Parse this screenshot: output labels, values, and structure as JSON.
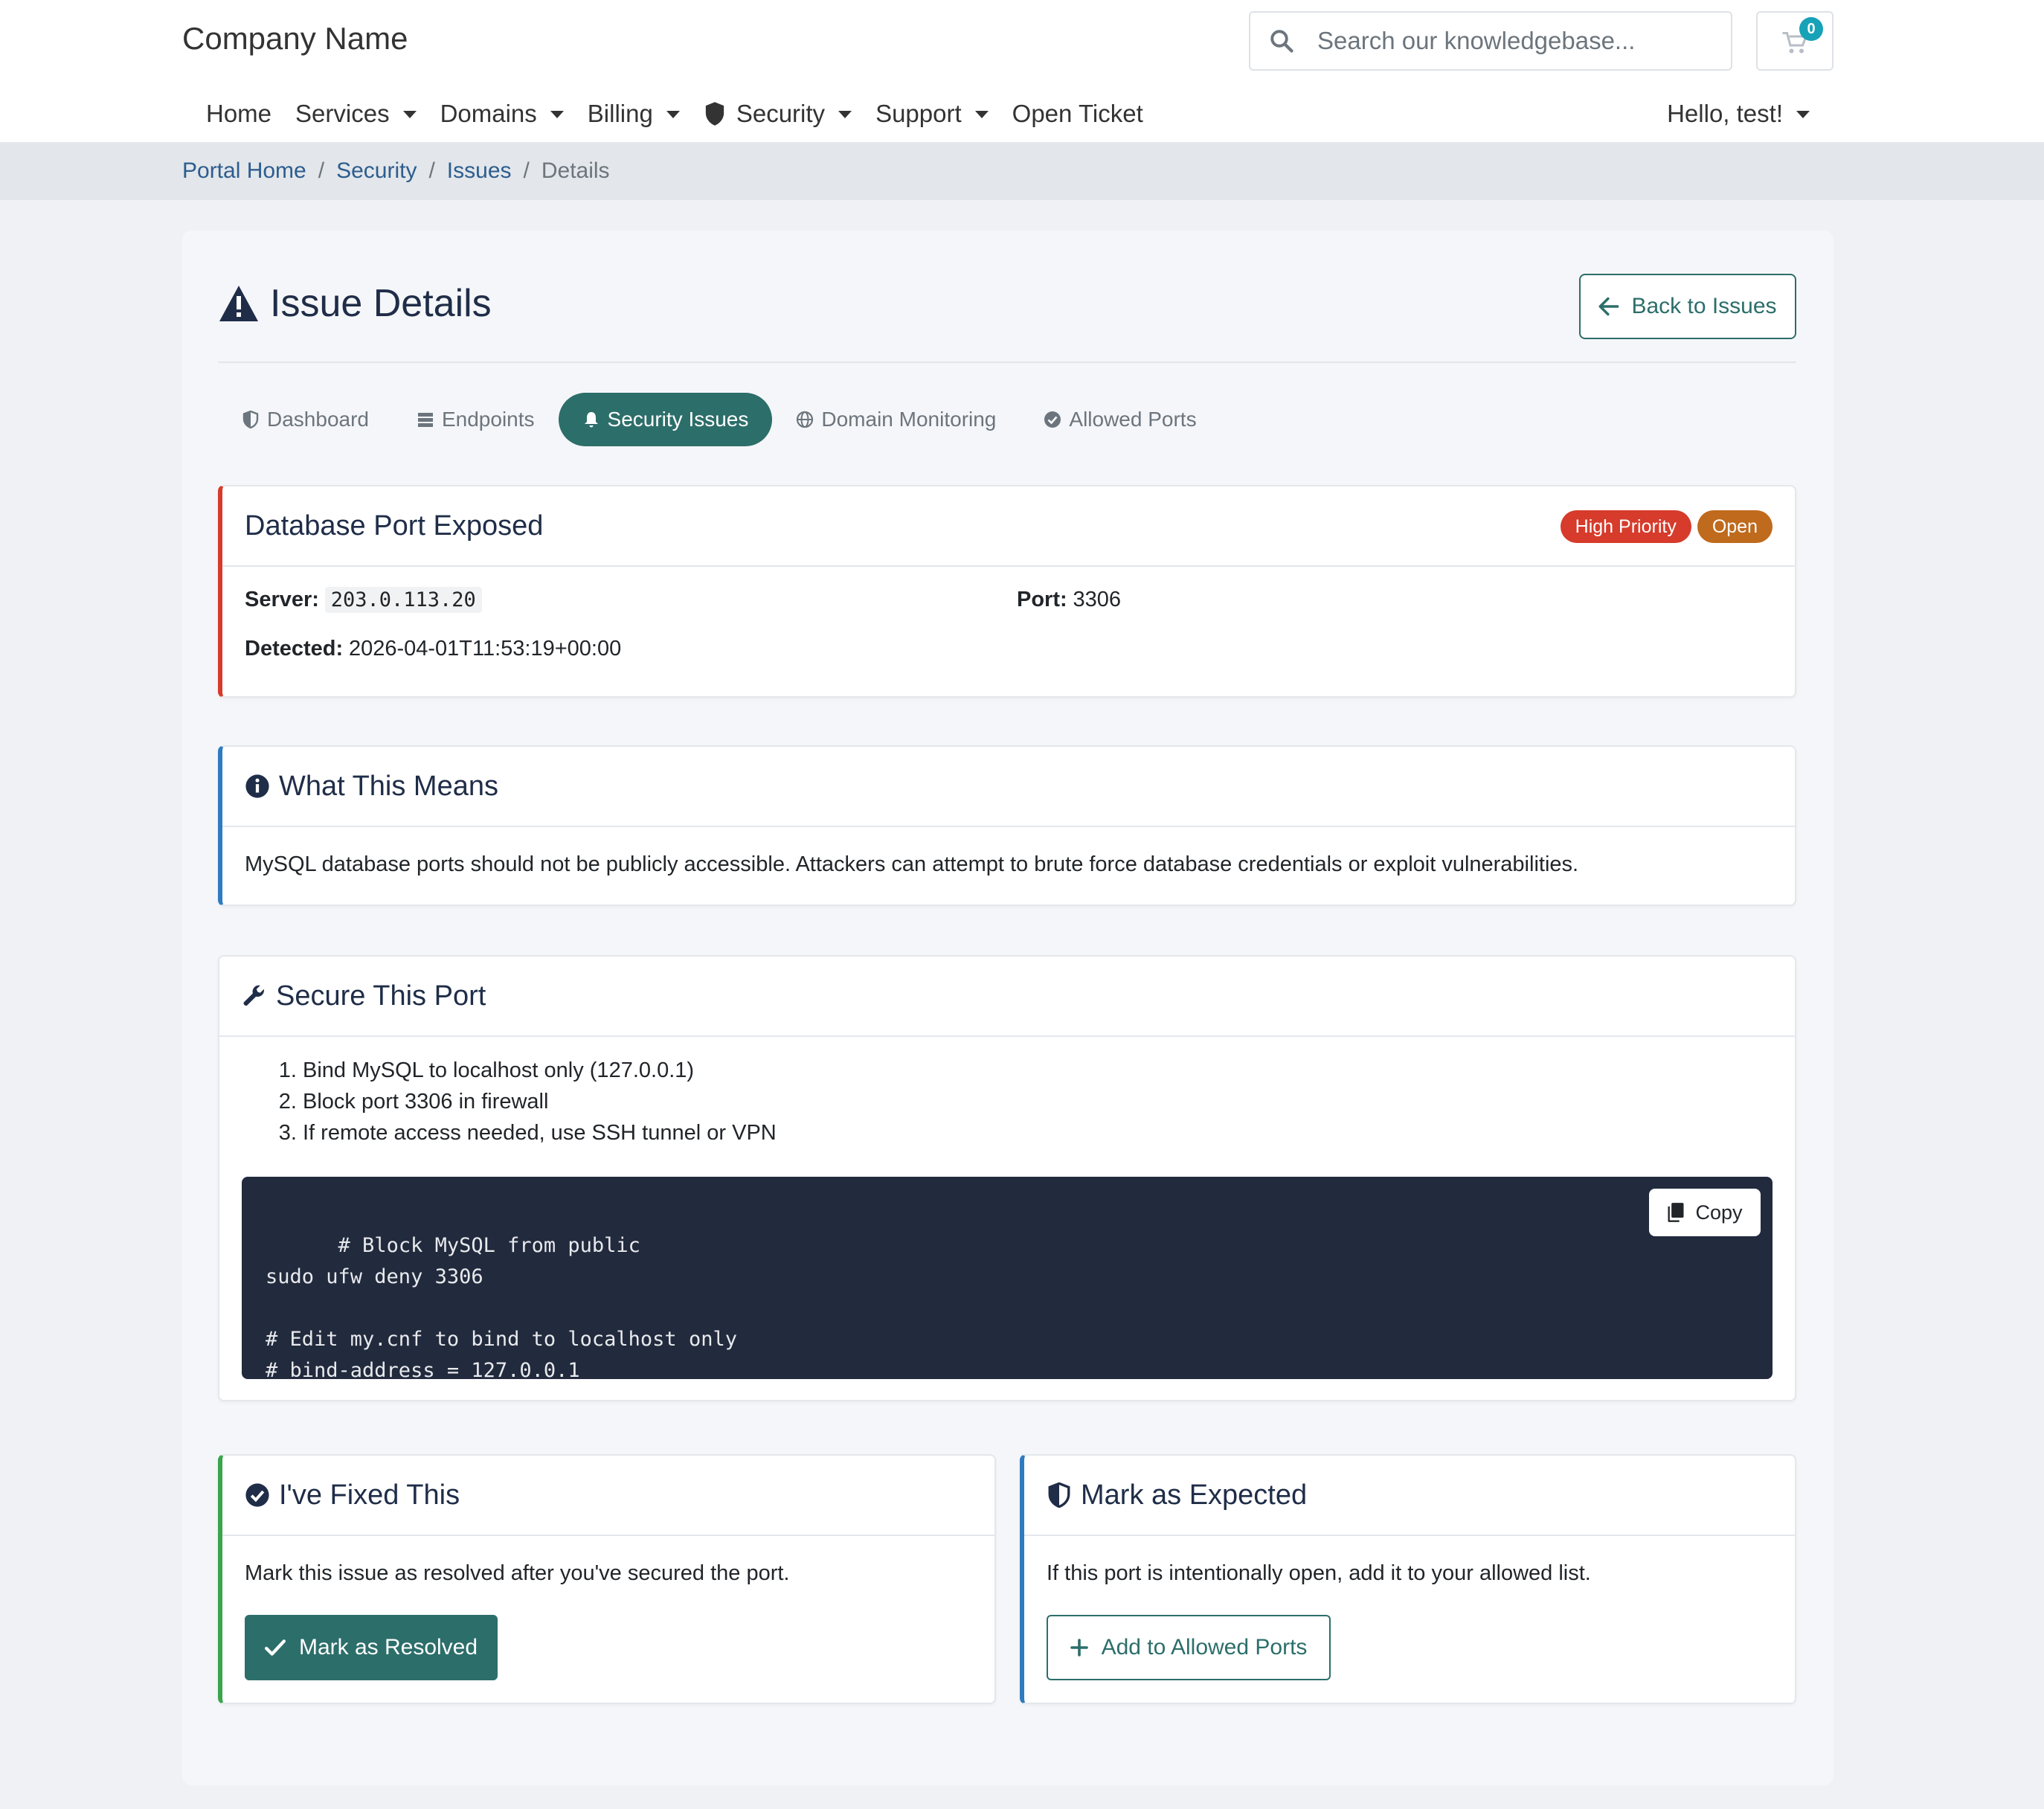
{
  "header": {
    "brand": "Company Name",
    "search_placeholder": "Search our knowledgebase...",
    "cart_count": "0"
  },
  "nav": {
    "items": [
      {
        "label": "Home"
      },
      {
        "label": "Services"
      },
      {
        "label": "Domains"
      },
      {
        "label": "Billing"
      },
      {
        "label": "Security"
      },
      {
        "label": "Support"
      },
      {
        "label": "Open Ticket"
      }
    ],
    "user_label": "Hello, test!"
  },
  "breadcrumb": {
    "items": [
      "Portal Home",
      "Security",
      "Issues"
    ],
    "active": "Details",
    "separator": "/"
  },
  "page": {
    "title": "Issue Details",
    "back_button": "Back to Issues"
  },
  "tabs": [
    {
      "label": "Dashboard",
      "icon": "shield-half-icon"
    },
    {
      "label": "Endpoints",
      "icon": "server-icon"
    },
    {
      "label": "Security Issues",
      "icon": "bell-icon",
      "active": true
    },
    {
      "label": "Domain Monitoring",
      "icon": "globe-icon"
    },
    {
      "label": "Allowed Ports",
      "icon": "check-circle-icon"
    }
  ],
  "issue": {
    "title": "Database Port Exposed",
    "priority_badge": "High Priority",
    "status_badge": "Open",
    "server_label": "Server:",
    "server_value": "203.0.113.20",
    "port_label": "Port:",
    "port_value": "3306",
    "detected_label": "Detected:",
    "detected_value": "2026-04-01T11:53:19+00:00"
  },
  "meaning": {
    "title": "What This Means",
    "body": "MySQL database ports should not be publicly accessible. Attackers can attempt to brute force database credentials or exploit vulnerabilities."
  },
  "secure": {
    "title": "Secure This Port",
    "steps": [
      "Bind MySQL to localhost only (127.0.0.1)",
      "Block port 3306 in firewall",
      "If remote access needed, use SSH tunnel or VPN"
    ],
    "code": "# Block MySQL from public\nsudo ufw deny 3306\n\n# Edit my.cnf to bind to localhost only\n# bind-address = 127.0.0.1",
    "copy_button": "Copy"
  },
  "fixed": {
    "title": "I've Fixed This",
    "body": "Mark this issue as resolved after you've secured the port.",
    "button": "Mark as Resolved"
  },
  "expected": {
    "title": "Mark as Expected",
    "body": "If this port is intentionally open, add it to your allowed list.",
    "button": "Add to Allowed Ports"
  },
  "colors": {
    "primary": "#2c6e6a",
    "danger": "#d63b2b",
    "warning": "#bf6a1d",
    "info": "#2f7bc0",
    "success": "#3aa54b",
    "code_bg": "#222a3d"
  }
}
